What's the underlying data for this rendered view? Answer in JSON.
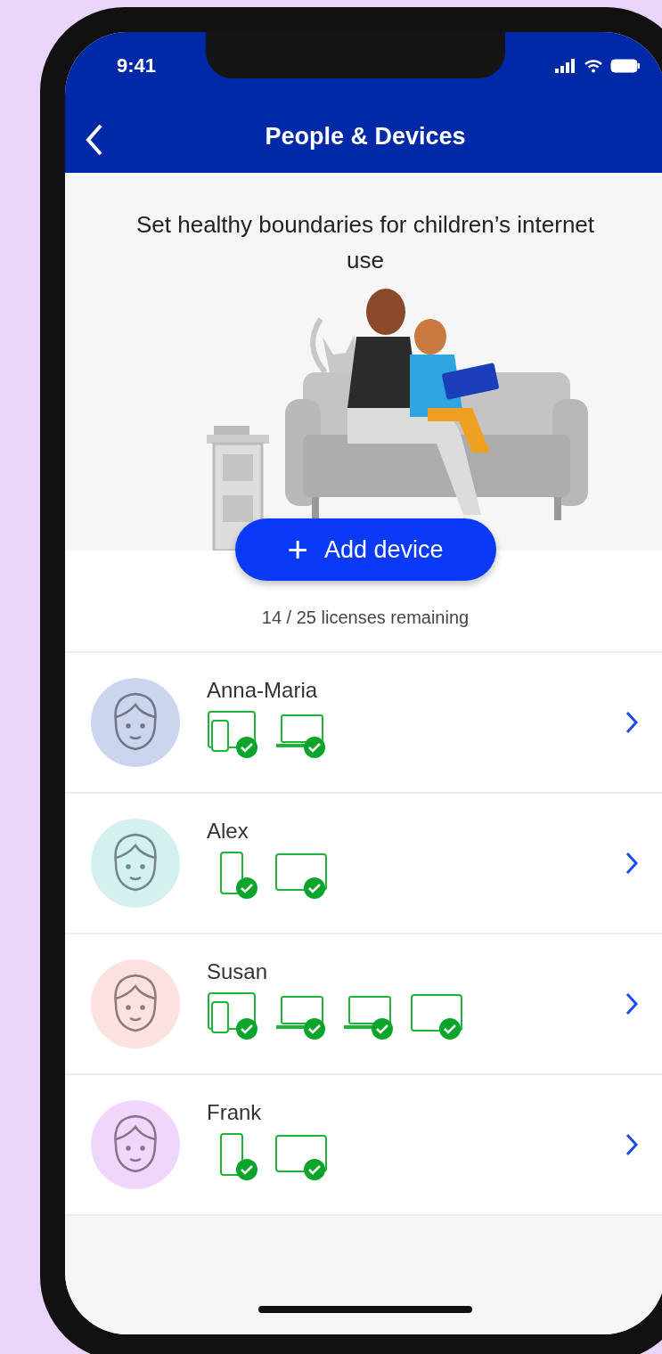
{
  "status_bar": {
    "time": "9:41"
  },
  "nav": {
    "title": "People & Devices"
  },
  "hero": {
    "headline": "Set healthy boundaries for children’s internet use"
  },
  "add_button": {
    "icon": "+",
    "label": "Add device"
  },
  "licenses": "14 / 25 licenses remaining",
  "people": [
    {
      "name": "Anna-Maria",
      "color": "#cbd6ee",
      "devices": [
        {
          "kind": "phone-tablet",
          "verified": true
        },
        {
          "kind": "laptop",
          "verified": true
        }
      ]
    },
    {
      "name": "Alex",
      "color": "#d3f1ee",
      "devices": [
        {
          "kind": "phone",
          "verified": true
        },
        {
          "kind": "tablet",
          "verified": true
        }
      ]
    },
    {
      "name": "Susan",
      "color": "#fde0e0",
      "devices": [
        {
          "kind": "phone-tablet",
          "verified": true
        },
        {
          "kind": "laptop",
          "verified": true
        },
        {
          "kind": "laptop",
          "verified": true
        },
        {
          "kind": "tablet",
          "verified": true
        }
      ]
    },
    {
      "name": "Frank",
      "color": "#f0d6fb",
      "devices": [
        {
          "kind": "phone",
          "verified": true
        },
        {
          "kind": "tablet",
          "verified": true
        }
      ]
    }
  ]
}
